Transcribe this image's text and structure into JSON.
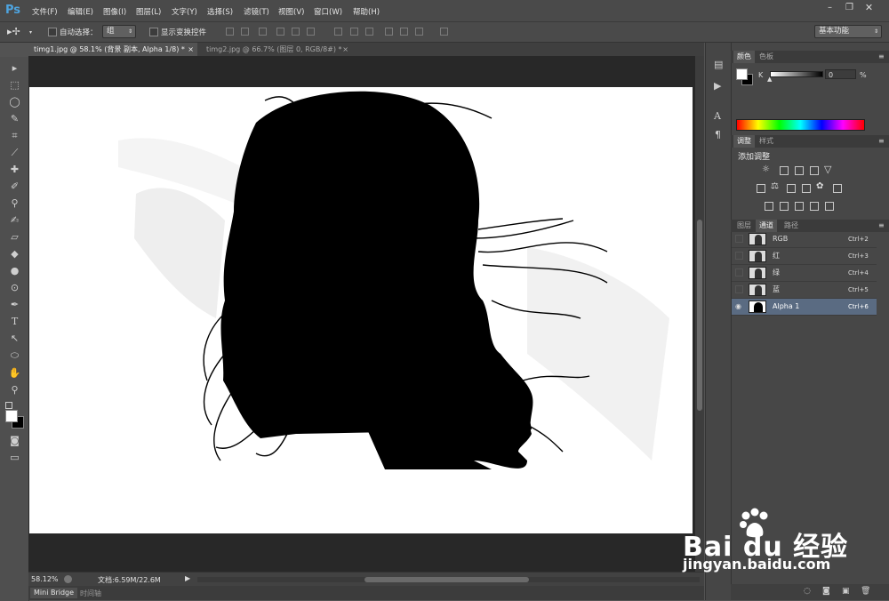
{
  "menubar": {
    "logo": "Ps",
    "items": [
      "文件(F)",
      "编辑(E)",
      "图像(I)",
      "图层(L)",
      "文字(Y)",
      "选择(S)",
      "滤镜(T)",
      "视图(V)",
      "窗口(W)",
      "帮助(H)"
    ]
  },
  "options": {
    "auto_select_label": "自动选择：",
    "auto_select_value": "组",
    "show_transform_label": "显示变换控件",
    "workspace": "基本功能"
  },
  "tabs": [
    {
      "label": "timg1.jpg @ 58.1% (背景 副本, Alpha 1/8) *",
      "close": "×"
    },
    {
      "label": "timg2.jpg @ 66.7% (图层 0, RGB/8#) *",
      "close": "×"
    }
  ],
  "status": {
    "zoom": "58.12%",
    "doc_size": "文档:6.59M/22.6M"
  },
  "bottom_tabs": [
    "Mini Bridge",
    "时间轴"
  ],
  "color_panel": {
    "tabs": [
      "颜色",
      "色板"
    ],
    "channel_label": "K",
    "value": "0",
    "unit": "%"
  },
  "adjust_panel": {
    "tabs": [
      "调整",
      "样式"
    ],
    "title": "添加调整"
  },
  "layers_panel": {
    "tabs": [
      "图层",
      "通道",
      "路径"
    ],
    "channels": [
      {
        "name": "RGB",
        "shortcut": "Ctrl+2"
      },
      {
        "name": "红",
        "shortcut": "Ctrl+3"
      },
      {
        "name": "绿",
        "shortcut": "Ctrl+4"
      },
      {
        "name": "蓝",
        "shortcut": "Ctrl+5"
      },
      {
        "name": "Alpha 1",
        "shortcut": "Ctrl+6"
      }
    ]
  },
  "watermark": {
    "brand": "Bai du 经验",
    "url": "jingyan.baidu.com"
  },
  "colors": {
    "accent": "#4ea4e0",
    "selected_row": "#5a6b82"
  }
}
